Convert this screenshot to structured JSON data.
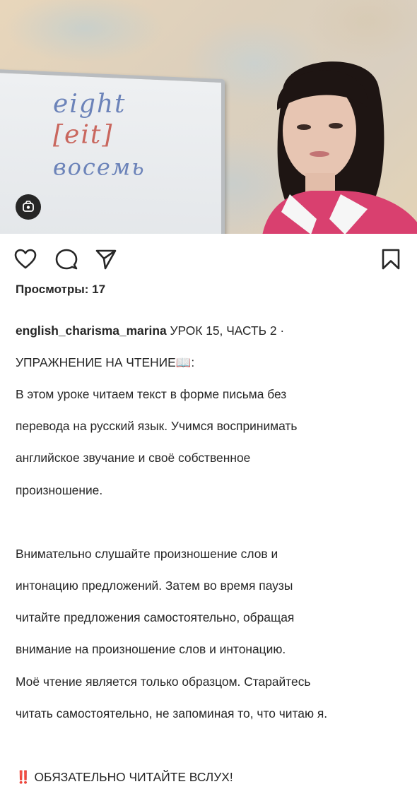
{
  "media": {
    "whiteboard_lines": [
      "eight",
      "[eit]",
      "восемь"
    ],
    "badge_icon": "reel-icon"
  },
  "actions": {
    "like_icon": "heart-icon",
    "comment_icon": "comment-icon",
    "share_icon": "send-icon",
    "save_icon": "bookmark-icon"
  },
  "post": {
    "views": "Просмотры: 17",
    "username": "english_charisma_marina",
    "caption_lines": [
      " УРОК 15, ЧАСТЬ 2 ·",
      "УПРАЖНЕНИЕ НА ЧТЕНИЕ📖:",
      "В этом уроке читаем текст в форме письма без",
      "перевода на русский язык. Учимся воспринимать",
      "английское звучание и своё собственное",
      "произношение.",
      "Внимательно слушайте произношение слов и",
      "интонацию предложений. Затем во время паузы",
      "читайте предложения  самостоятельно, обращая",
      "внимание на произношение слов и интонацию.",
      "Моё чтение является только образцом. Старайтесь",
      "читать самостоятельно, не запоминая то, что читаю я.",
      "‼️",
      " ОБЯЗАТЕЛЬНО ЧИТАЙТЕ ВСЛУХ!"
    ]
  }
}
